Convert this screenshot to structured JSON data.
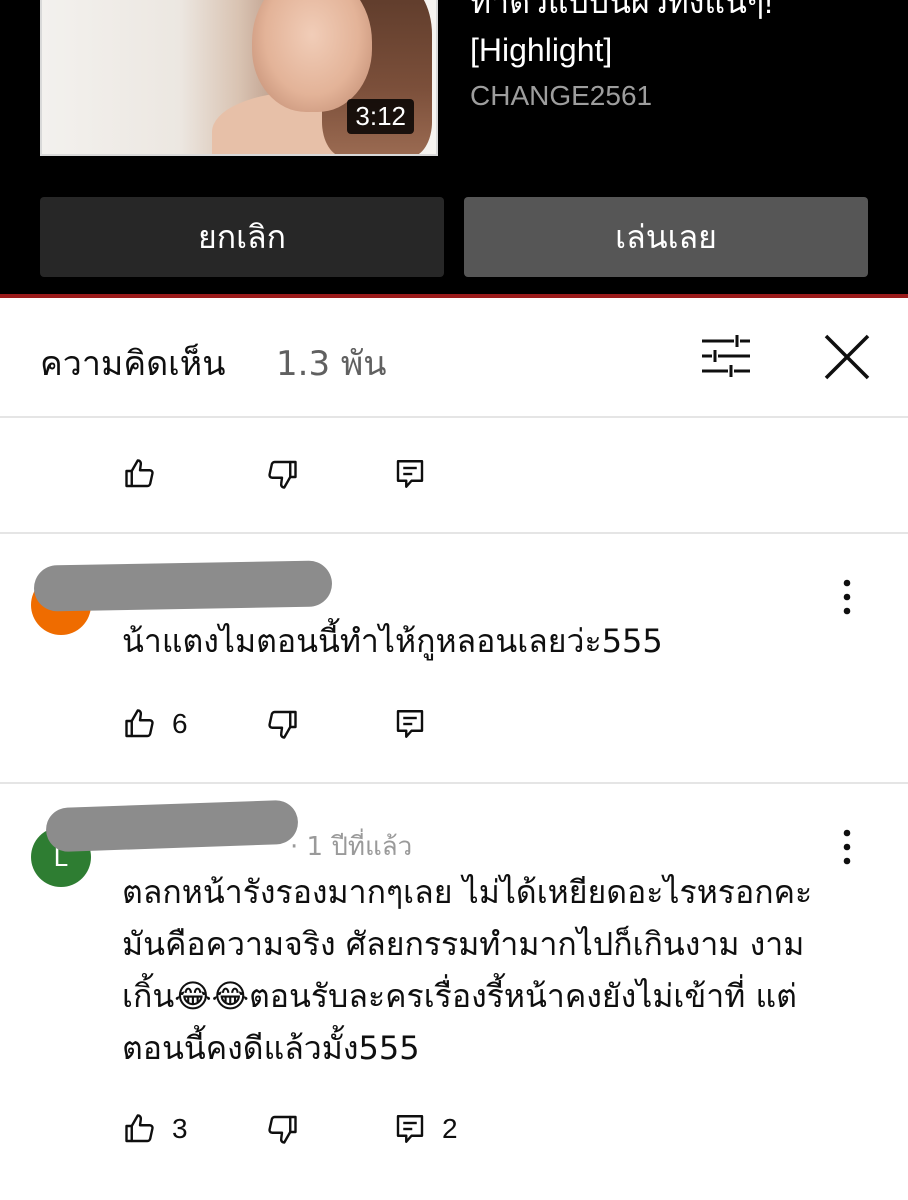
{
  "up_next": {
    "title_line1": "ท่าตัวแบบนี้ผัวทิ้งแน่ๆ!",
    "title_line2": "[Highlight]",
    "channel": "CHANGE2561",
    "duration": "3:12",
    "cancel_label": "ยกเลิก",
    "play_label": "เล่นเลย"
  },
  "comments_header": {
    "title": "ความคิดเห็น",
    "count": "1.3 พัน",
    "filter_icon": "sort-filter-icon",
    "close_icon": "close-icon"
  },
  "comments": [
    {
      "avatar_letter": "",
      "avatar_color": "#ef6c00",
      "author_meta": "",
      "text": "น้าแตงไมตอนนี้ทำไห้กูหลอนเลยว่ะ555",
      "likes": "6",
      "replies": ""
    },
    {
      "avatar_letter": "L",
      "avatar_color": "#2e7d32",
      "author_meta": "· 1 ปีที่แล้ว",
      "text_lines": [
        "ตลกหน้ารังรองมากๆเลย  ไม่ได้เหยียดอะไรหรอกคะ",
        "มันคือความจริง  ศัลยกรรมทำมากไปก็เกินงาม  งาม",
        "เกิ้น😂😂ตอนรับละครเรื่องรี้หน้าคงยังไม่เข้าที่  แต่",
        "ตอนนี้คงดีแล้วมั้ง555"
      ],
      "likes": "3",
      "replies": "2"
    }
  ],
  "colors": {
    "accent_red": "#9b1b1b",
    "button_cancel": "#272727",
    "button_play": "#565656"
  },
  "icons": [
    "thumb-up-icon",
    "thumb-down-icon",
    "reply-icon",
    "more-vert-icon"
  ]
}
